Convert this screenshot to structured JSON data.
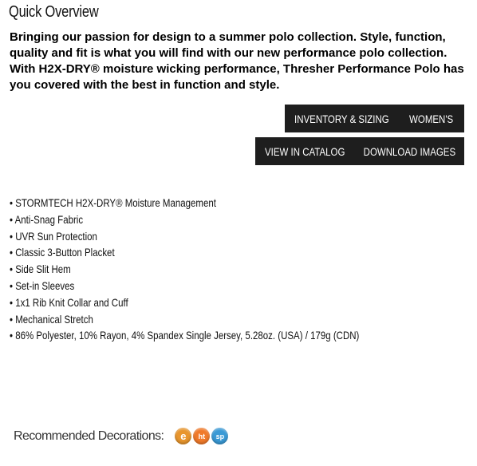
{
  "heading": "Quick Overview",
  "description": "Bringing our passion for design to a summer polo collection. Style, function, quality and fit is what you will find with our new performance polo collection. With H2X-DRY® moisture wicking performance, Thresher Performance Polo has you covered with the best in function and style.",
  "buttons": {
    "inventory_sizing": "INVENTORY & SIZING",
    "womens": "WOMEN'S",
    "view_catalog": "VIEW IN CATALOG",
    "download_images": "DOWNLOAD IMAGES"
  },
  "features": [
    "• STORMTECH H2X-DRY® Moisture Management",
    "• Anti-Snag Fabric",
    "• UVR Sun Protection",
    "• Classic 3-Button Placket",
    "• Side Slit Hem",
    "• Set-in Sleeves",
    "• 1x1 Rib Knit Collar and Cuff",
    "• Mechanical Stretch",
    "• 86% Polyester, 10% Rayon, 4% Spandex Single Jersey, 5.28oz. (USA) / 179g (CDN)"
  ],
  "recommended": {
    "label": "Recommended Decorations:",
    "icons": [
      {
        "name": "embroidery-icon",
        "text": "e",
        "color": "#e8962e"
      },
      {
        "name": "heat-transfer-icon",
        "text": "ht",
        "color": "#f07a2a"
      },
      {
        "name": "screen-print-icon",
        "text": "sp",
        "color": "#3a9ad6"
      }
    ]
  },
  "colors": {
    "button_bg": "#1e1e1e",
    "button_text": "#ffffff"
  }
}
